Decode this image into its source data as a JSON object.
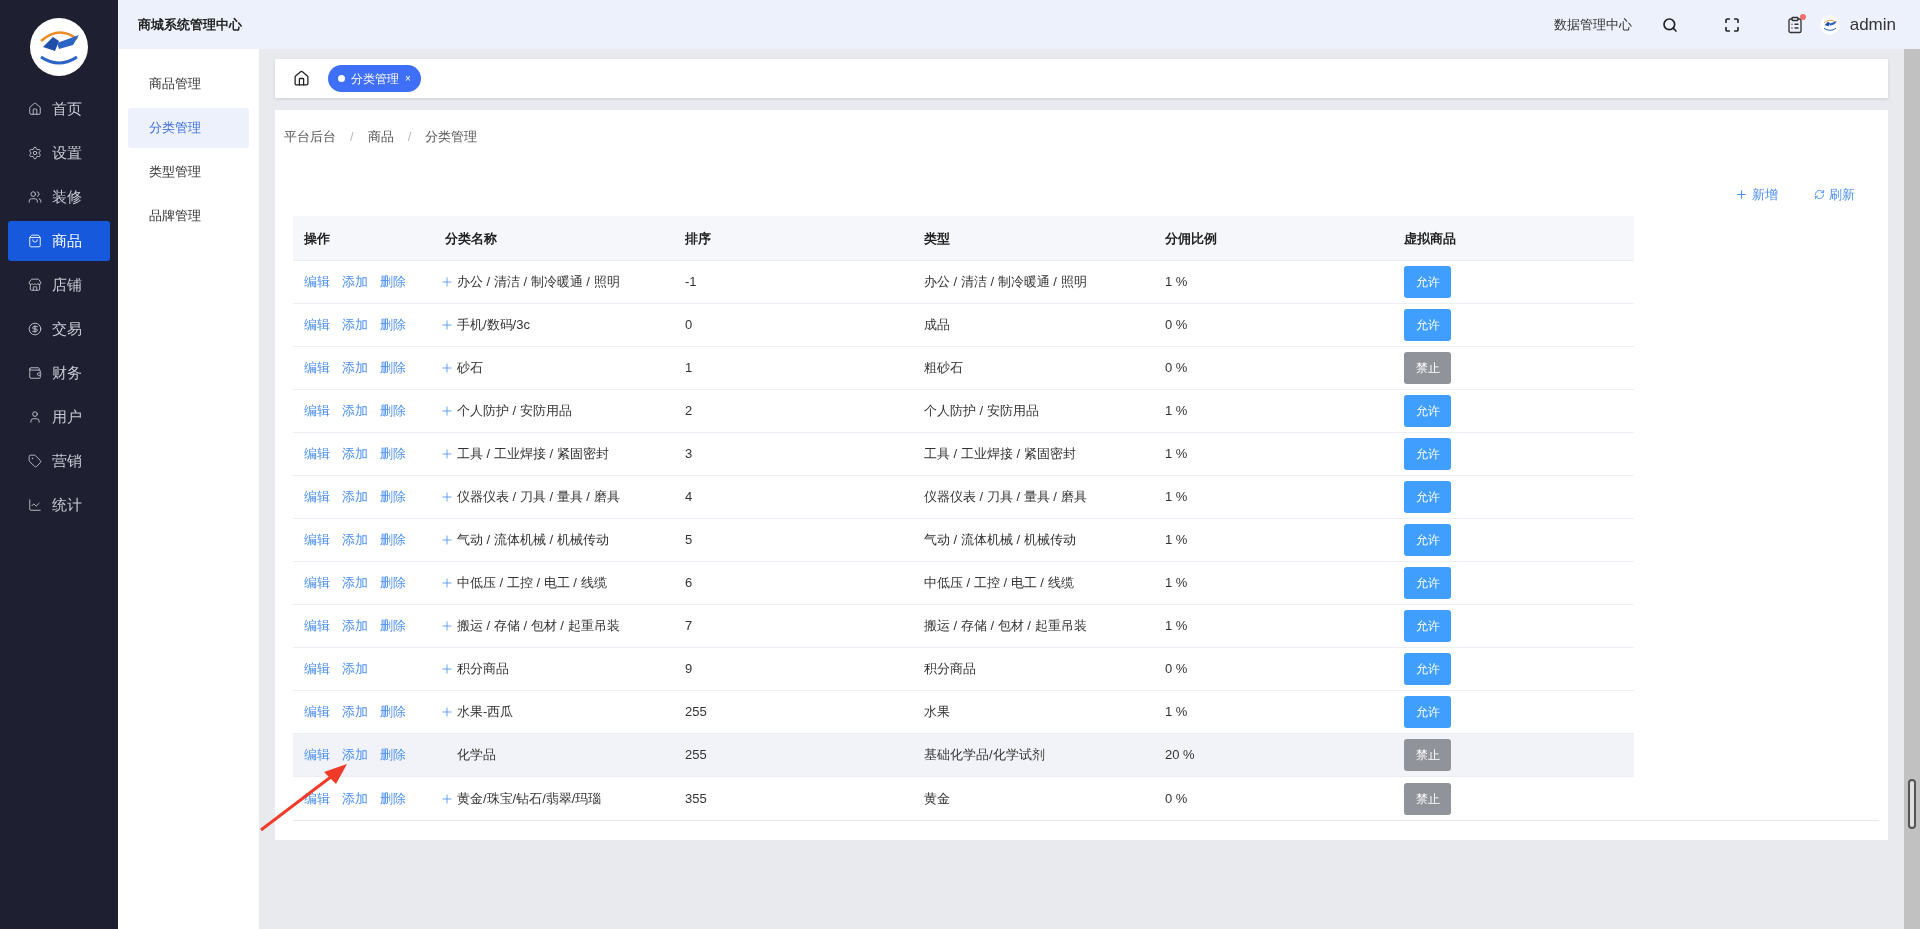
{
  "header": {
    "title": "商城系统管理中心",
    "data_center": "数据管理中心",
    "notification_dot": true,
    "user": "admin"
  },
  "nav": [
    {
      "label": "首页",
      "selected": false
    },
    {
      "label": "设置",
      "selected": false
    },
    {
      "label": "装修",
      "selected": false
    },
    {
      "label": "商品",
      "selected": true
    },
    {
      "label": "店铺",
      "selected": false
    },
    {
      "label": "交易",
      "selected": false
    },
    {
      "label": "财务",
      "selected": false
    },
    {
      "label": "用户",
      "selected": false
    },
    {
      "label": "营销",
      "selected": false
    },
    {
      "label": "统计",
      "selected": false
    }
  ],
  "submenu": [
    {
      "label": "商品管理",
      "selected": false
    },
    {
      "label": "分类管理",
      "selected": true
    },
    {
      "label": "类型管理",
      "selected": false
    },
    {
      "label": "品牌管理",
      "selected": false
    }
  ],
  "tabs": [
    {
      "label": "分类管理",
      "close": "×",
      "selected": true
    }
  ],
  "breadcrumb": [
    {
      "kind": "item",
      "text": "平台后台"
    },
    {
      "kind": "separator",
      "text": "/"
    },
    {
      "kind": "item",
      "text": "商品"
    },
    {
      "kind": "separator",
      "text": "/"
    },
    {
      "kind": "item",
      "text": "分类管理"
    }
  ],
  "toolbar": {
    "add": "新增",
    "refresh": "刷新"
  },
  "table": {
    "columns": [
      "操作",
      "分类名称",
      "排序",
      "类型",
      "分佣比例",
      "虚拟商品"
    ],
    "rows": [
      {
        "actions": [
          "编辑",
          "添加",
          "删除"
        ],
        "name": "办公 / 清洁 / 制冷暖通 / 照明",
        "expandable": true,
        "sort": "-1",
        "type": "办公 / 清洁 / 制冷暖通 / 照明",
        "commission": "1 %",
        "virtual": "允许",
        "allowed": true,
        "highlighted": false
      },
      {
        "actions": [
          "编辑",
          "添加",
          "删除"
        ],
        "name": "手机/数码/3c",
        "expandable": true,
        "sort": "0",
        "type": "成品",
        "commission": "0 %",
        "virtual": "允许",
        "allowed": true,
        "highlighted": false
      },
      {
        "actions": [
          "编辑",
          "添加",
          "删除"
        ],
        "name": "砂石",
        "expandable": true,
        "sort": "1",
        "type": "粗砂石",
        "commission": "0 %",
        "virtual": "禁止",
        "allowed": false,
        "highlighted": false
      },
      {
        "actions": [
          "编辑",
          "添加",
          "删除"
        ],
        "name": "个人防护 / 安防用品",
        "expandable": true,
        "sort": "2",
        "type": "个人防护 / 安防用品",
        "commission": "1 %",
        "virtual": "允许",
        "allowed": true,
        "highlighted": false
      },
      {
        "actions": [
          "编辑",
          "添加",
          "删除"
        ],
        "name": "工具 / 工业焊接 / 紧固密封",
        "expandable": true,
        "sort": "3",
        "type": "工具 / 工业焊接 / 紧固密封",
        "commission": "1 %",
        "virtual": "允许",
        "allowed": true,
        "highlighted": false
      },
      {
        "actions": [
          "编辑",
          "添加",
          "删除"
        ],
        "name": "仪器仪表 / 刀具 / 量具 / 磨具",
        "expandable": true,
        "sort": "4",
        "type": "仪器仪表 / 刀具 / 量具 / 磨具",
        "commission": "1 %",
        "virtual": "允许",
        "allowed": true,
        "highlighted": false
      },
      {
        "actions": [
          "编辑",
          "添加",
          "删除"
        ],
        "name": "气动 / 流体机械 / 机械传动",
        "expandable": true,
        "sort": "5",
        "type": "气动 / 流体机械 / 机械传动",
        "commission": "1 %",
        "virtual": "允许",
        "allowed": true,
        "highlighted": false
      },
      {
        "actions": [
          "编辑",
          "添加",
          "删除"
        ],
        "name": "中低压 / 工控 / 电工 / 线缆",
        "expandable": true,
        "sort": "6",
        "type": "中低压 / 工控 / 电工 / 线缆",
        "commission": "1 %",
        "virtual": "允许",
        "allowed": true,
        "highlighted": false
      },
      {
        "actions": [
          "编辑",
          "添加",
          "删除"
        ],
        "name": "搬运 / 存储 / 包材 / 起重吊装",
        "expandable": true,
        "sort": "7",
        "type": "搬运 / 存储 / 包材 / 起重吊装",
        "commission": "1 %",
        "virtual": "允许",
        "allowed": true,
        "highlighted": false
      },
      {
        "actions": [
          "编辑",
          "添加"
        ],
        "name": "积分商品",
        "expandable": true,
        "sort": "9",
        "type": "积分商品",
        "commission": "0 %",
        "virtual": "允许",
        "allowed": true,
        "highlighted": false
      },
      {
        "actions": [
          "编辑",
          "添加",
          "删除"
        ],
        "name": "水果-西瓜",
        "expandable": true,
        "sort": "255",
        "type": "水果",
        "commission": "1 %",
        "virtual": "允许",
        "allowed": true,
        "highlighted": false
      },
      {
        "actions": [
          "编辑",
          "添加",
          "删除"
        ],
        "name": "化学品",
        "expandable": false,
        "sort": "255",
        "type": "基础化学品/化学试剂",
        "commission": "20 %",
        "virtual": "禁止",
        "allowed": false,
        "highlighted": true
      },
      {
        "actions": [
          "编辑",
          "添加",
          "删除"
        ],
        "name": "黄金/珠宝/钻石/翡翠/玛瑙",
        "expandable": true,
        "sort": "355",
        "type": "黄金",
        "commission": "0 %",
        "virtual": "禁止",
        "allowed": false,
        "highlighted": false
      }
    ]
  },
  "annotation": {
    "kind": "arrow"
  }
}
